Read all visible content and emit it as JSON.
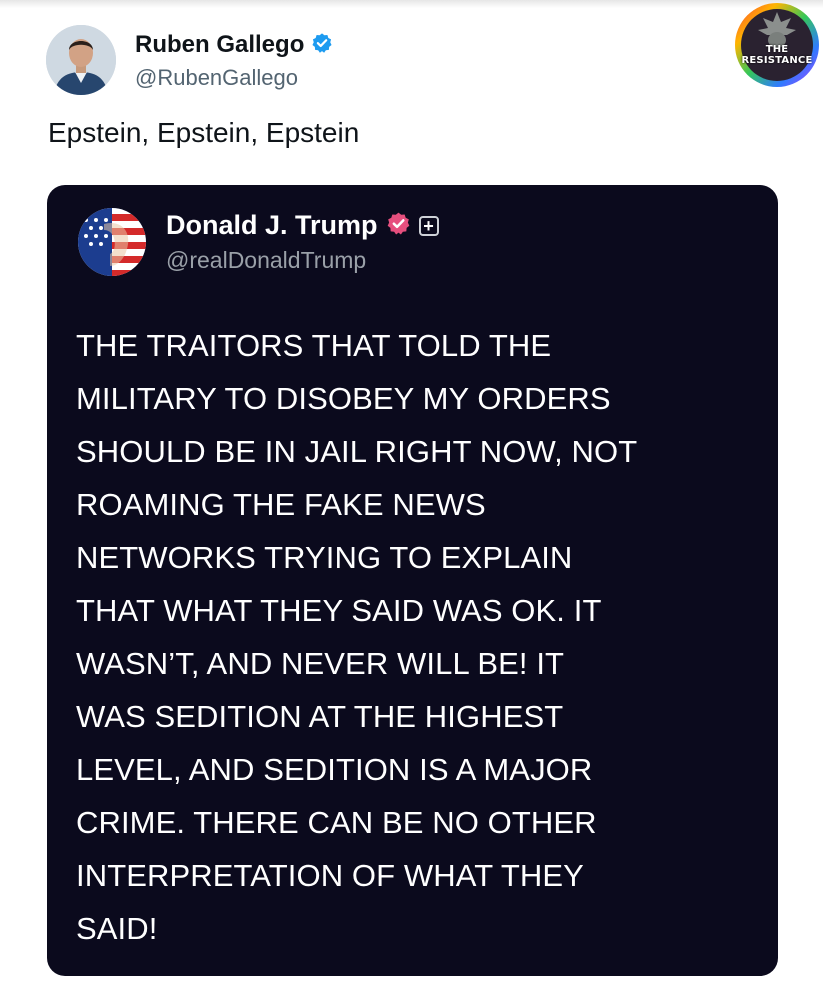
{
  "tweet": {
    "author_name": "Ruben Gallego",
    "author_handle": "@RubenGallego",
    "text": "Epstein, Epstein, Epstein",
    "verified_icon": "blue-verified-badge-icon"
  },
  "watermark": {
    "line1": "THE",
    "line2": "RESISTANCE"
  },
  "quoted_post": {
    "author_name": "Donald J. Trump",
    "author_handle": "@realDonaldTrump",
    "verified_icon": "pink-verified-badge-icon",
    "follow_icon": "plus-icon",
    "body_lines": [
      "THE TRAITORS THAT TOLD THE",
      "MILITARY TO DISOBEY MY ORDERS",
      "SHOULD BE IN JAIL RIGHT NOW, NOT",
      "ROAMING THE FAKE NEWS",
      "NETWORKS TRYING TO EXPLAIN",
      "THAT WHAT THEY SAID WAS OK. IT",
      "WASN’T, AND NEVER WILL BE! IT",
      "WAS SEDITION AT THE HIGHEST",
      "LEVEL, AND SEDITION IS A MAJOR",
      "CRIME. THERE CAN BE NO OTHER",
      "INTERPRETATION OF WHAT THEY",
      "SAID!"
    ]
  },
  "colors": {
    "verified_blue": "#1d9bf0",
    "verified_pink": "#e64f7e",
    "quote_background": "#0b0a1d",
    "handle_gray": "#536471"
  }
}
